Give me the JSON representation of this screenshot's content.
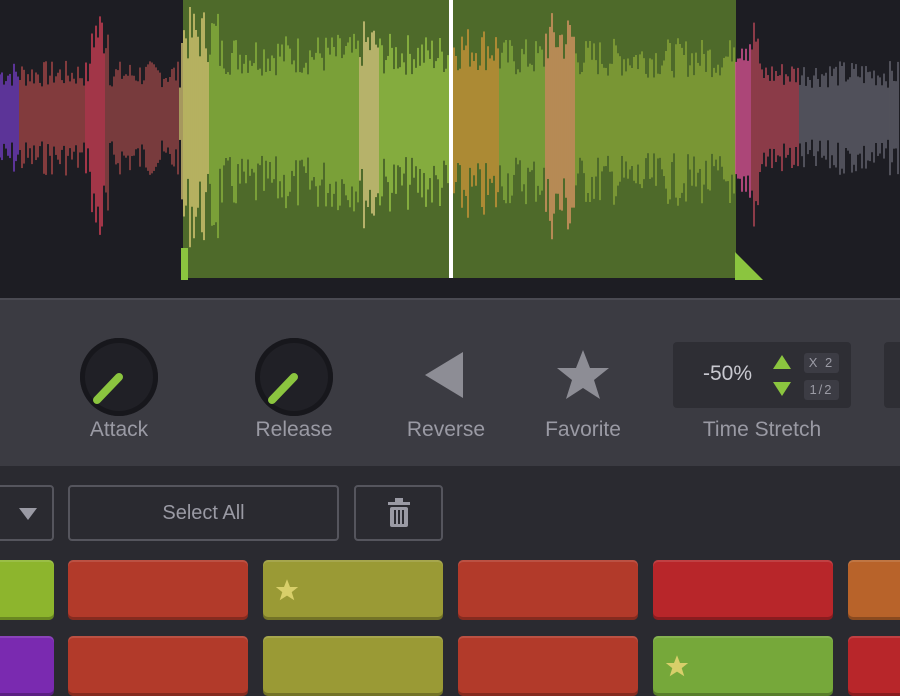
{
  "controls": {
    "attack_label": "Attack",
    "release_label": "Release",
    "reverse_label": "Reverse",
    "favorite_label": "Favorite",
    "time_stretch_label": "Time Stretch",
    "time_stretch_value": "-50%",
    "time_stretch_double": "X 2",
    "time_stretch_half": "1/2"
  },
  "toolbar": {
    "select_all_label": "Select All"
  },
  "colors": {
    "accent_green": "#8bc53f",
    "region_green": "#4e6a2a",
    "pad_red": "#b23a2a",
    "pad_olive": "#9a9a35",
    "pad_crimson": "#b8262a",
    "pad_orange": "#b8632a",
    "pad_lime": "#8db52d",
    "pad_purple": "#7a2ab0",
    "pad_green": "#76a83a"
  },
  "pads": [
    {
      "color": "#8db52d",
      "favorite": false
    },
    {
      "color": "#b23a2a",
      "favorite": false
    },
    {
      "color": "#9a9a35",
      "favorite": true
    },
    {
      "color": "#b23a2a",
      "favorite": false
    },
    {
      "color": "#b8262a",
      "favorite": false
    },
    {
      "color": "#b8632a",
      "favorite": false
    },
    {
      "color": "#7a2ab0",
      "favorite": false
    },
    {
      "color": "#b23a2a",
      "favorite": false
    },
    {
      "color": "#9a9a35",
      "favorite": false
    },
    {
      "color": "#b23a2a",
      "favorite": false
    },
    {
      "color": "#76a83a",
      "favorite": true
    },
    {
      "color": "#b8262a",
      "favorite": false
    }
  ]
}
